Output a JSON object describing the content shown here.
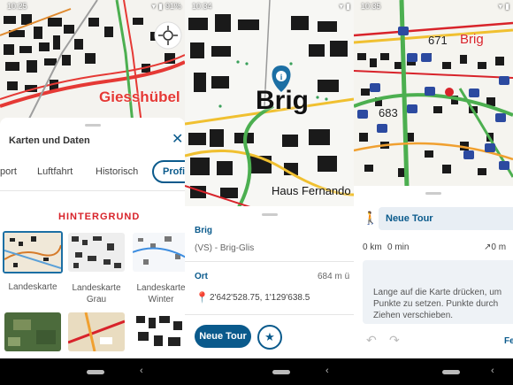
{
  "status": [
    {
      "time": "10:25",
      "battery": "91%"
    },
    {
      "time": "10:34",
      "battery": ""
    },
    {
      "time": "10:35",
      "battery": ""
    }
  ],
  "screen1": {
    "map_label": "Giesshübel",
    "sheet_title": "Karten und Daten",
    "tabs": [
      "port",
      "Luftfahrt",
      "Historisch",
      "Profi"
    ],
    "section_heading": "HINTERGRUND",
    "maps": [
      {
        "line1": "Landeskarte",
        "line2": ""
      },
      {
        "line1": "Landeskarte",
        "line2": "Grau"
      },
      {
        "line1": "Landeskarte",
        "line2": "Winter"
      }
    ]
  },
  "screen2": {
    "map_label": "Brig",
    "map_label_small": "Haus Fernando",
    "place_heading": "Brig",
    "place_sub": "(VS) - Brig-Glis",
    "location_heading": "Ort",
    "altitude": "684 m ü",
    "coordinates": "2'642'528.75, 1'129'638.5",
    "new_tour_label": "Neue Tour"
  },
  "screen3": {
    "map_label_num1": "671",
    "map_label_brig": "Brig",
    "map_label_num2": "683",
    "tour_title": "Neue Tour",
    "distance": "0 km",
    "duration": "0 min",
    "ascent": "↗0 m",
    "hint": "Lange auf die Karte drücken, um Punkte zu setzen. Punkte durch Ziehen verschieben.",
    "save_partial": "Fe"
  },
  "colors": {
    "accent": "#0a5a8c",
    "red_heading": "#d8232a",
    "marker": "#1c6fa4"
  }
}
